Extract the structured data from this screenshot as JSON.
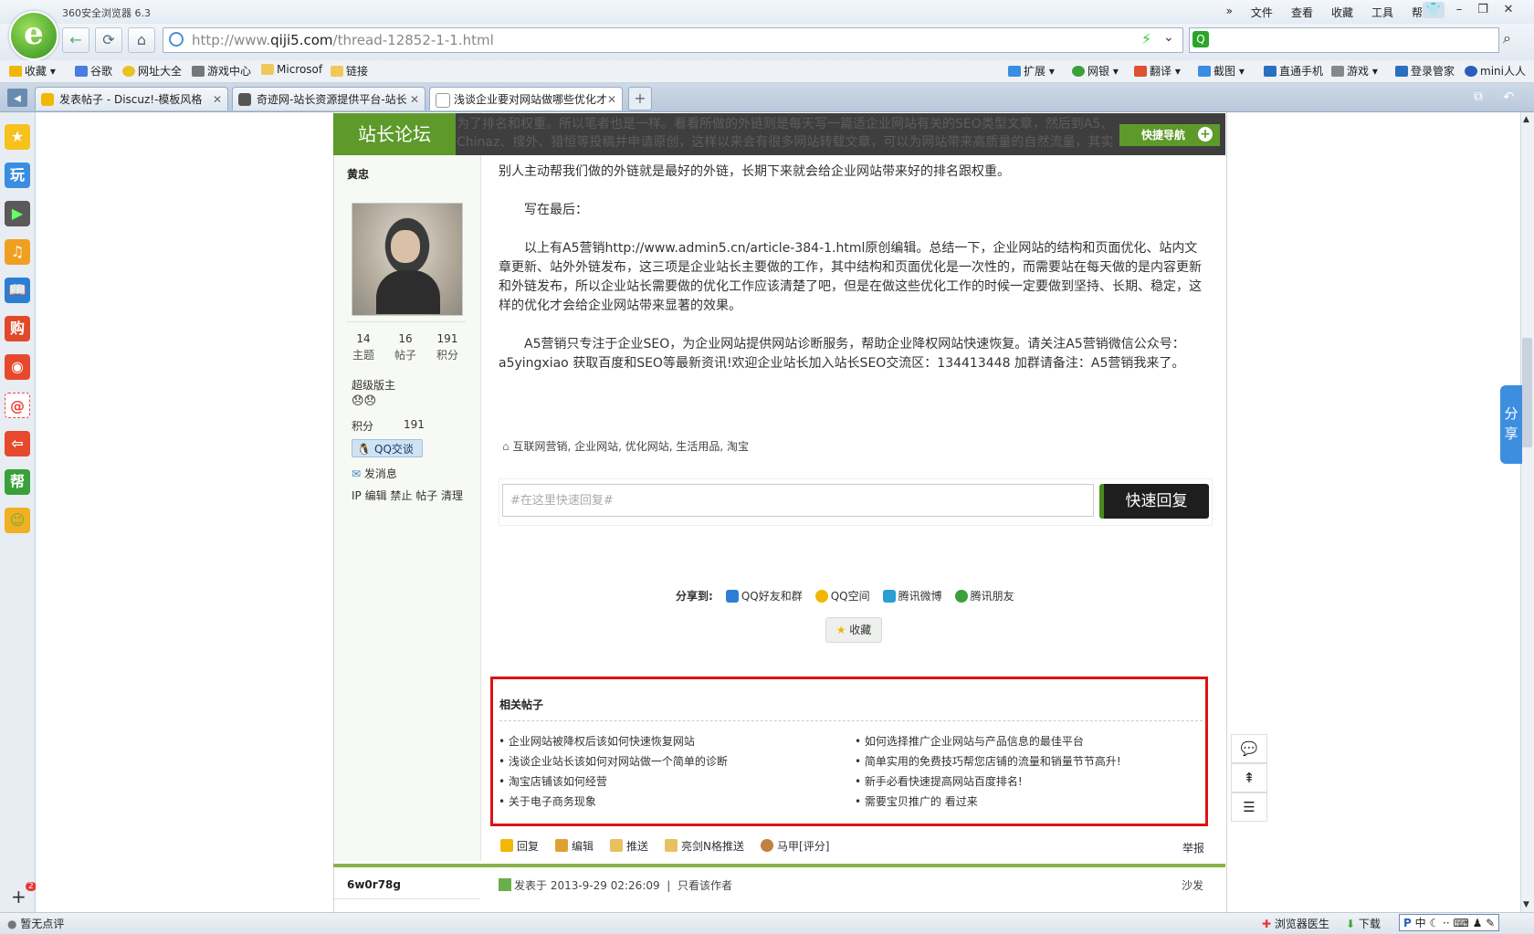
{
  "browser": {
    "app_title": "360安全浏览器 6.3",
    "menu": [
      "文件",
      "查看",
      "收藏",
      "工具",
      "帮助"
    ],
    "address_prefix": "http://www.",
    "address_domain": "qiji5.com",
    "address_path": "/thread-12852-1-1.html",
    "bookmarks": [
      "收藏",
      "谷歌",
      "网址大全",
      "游戏中心",
      "Microsof",
      "链接"
    ],
    "toolbar_right": [
      "扩展",
      "网银",
      "翻译",
      "截图",
      "直通手机",
      "游戏",
      "登录管家",
      "mini人人"
    ],
    "tabs": [
      "发表帖子 - Discuz!-模板风格",
      "奇迹网-站长资源提供平台-站长",
      "浅谈企业要对网站做哪些优化才"
    ],
    "status_left": "暂无点评",
    "status_right": [
      "浏览器医生",
      "下载"
    ],
    "ime": "中"
  },
  "sidebar": {
    "icons": [
      "收藏",
      "玩",
      "视频",
      "音乐",
      "阅读",
      "购",
      "微博",
      "邮件",
      "退出",
      "帮",
      "笑脸"
    ],
    "badge": "2"
  },
  "forum": {
    "logo_text": "站长论坛",
    "quick_nav": "快捷导航",
    "header_ghost": "为了排名和权重。所以笔者也是一样。看看所做的外链则是每天写一篇适企业网站有关的SEO类型文章，然后到A5、Chinaz、搜外、猎恒等投稿并申请原创，这样以来会有很多网站转载文章，可以为网站带来高质量的自然流量，其实说白了，"
  },
  "author": {
    "name": "黄忠",
    "stats": [
      {
        "value": "14",
        "label": "主题"
      },
      {
        "value": "16",
        "label": "帖子"
      },
      {
        "value": "191",
        "label": "积分"
      }
    ],
    "rank": "超级版主",
    "emoji": "😞😞",
    "points_label": "积分",
    "points_value": "191",
    "qq_label": "QQ交谈",
    "message_label": "发消息",
    "admin_links": "IP 编辑 禁止 帖子 清理"
  },
  "article": {
    "p0": "别人主动帮我们做的外链就是最好的外链，长期下来就会给企业网站带来好的排名跟权重。",
    "p1": "写在最后：",
    "p2": "以上有A5营销http://www.admin5.cn/article-384-1.html原创编辑。总结一下，企业网站的结构和页面优化、站内文章更新、站外外链发布，这三项是企业站长主要做的工作，其中结构和页面优化是一次性的，而需要站在每天做的是内容更新和外链发布，所以企业站长需要做的优化工作应该清楚了吧，但是在做这些优化工作的时候一定要做到坚持、长期、稳定，这样的优化才会给企业网站带来显著的效果。",
    "p3": "A5营销只专注于企业SEO，为企业网站提供网站诊断服务，帮助企业降权网站快速恢复。请关注A5营销微信公众号：a5yingxiao 获取百度和SEO等最新资讯!欢迎企业站长加入站长SEO交流区：134413448 加群请备注：A5营销我来了。",
    "tags": "互联网营销, 企业网站, 优化网站, 生活用品, 淘宝",
    "reply_placeholder": "#在这里快速回复#",
    "reply_button": "快速回复",
    "share_label": "分享到:",
    "share_items": [
      "QQ好友和群",
      "QQ空间",
      "腾讯微博",
      "腾讯朋友"
    ],
    "favorite": "收藏"
  },
  "related": {
    "title": "相关帖子",
    "left": [
      "企业网站被降权后该如何快速恢复网站",
      "浅谈企业站长该如何对网站做一个简单的诊断",
      "淘宝店铺该如何经营",
      "关于电子商务现象"
    ],
    "right": [
      "如何选择推广企业网站与产品信息的最佳平台",
      "简单实用的免费技巧帮您店铺的流量和销量节节高升!",
      "新手必看快速提高网站百度排名!",
      "需要宝贝推广的 看过来"
    ]
  },
  "actions": {
    "items": [
      "回复",
      "编辑",
      "推送",
      "亮剑N格推送",
      "马甲[评分]"
    ],
    "report": "举报"
  },
  "post2": {
    "user": "6w0r78g",
    "meta": "发表于 2013-9-29 02:26:09",
    "only_author": "只看该作者",
    "floor": "沙发"
  },
  "float": {
    "share": "分享"
  }
}
